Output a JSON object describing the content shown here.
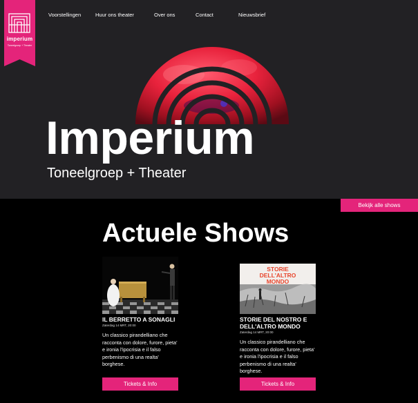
{
  "brand": {
    "logo_text": "imperium",
    "logo_tagline": "Toneelgroep + Theater",
    "color": "#e4247a"
  },
  "nav": {
    "items": [
      {
        "label": "Voorstellingen"
      },
      {
        "label": "Huur ons theater"
      },
      {
        "label": "Over ons"
      },
      {
        "label": "Contact"
      },
      {
        "label": "Nieuwsbrief"
      }
    ]
  },
  "hero": {
    "title": "Imperium",
    "subtitle": "Toneelgroep + Theater"
  },
  "shows_section": {
    "all_shows_label": "Bekijk alle shows",
    "title": "Actuele Shows",
    "shows": [
      {
        "title": "IL BERRETTO A SONAGLI",
        "date": "Zaterdag 14 MRT, 20:00",
        "description": "Un classico pirandelliano che racconta con dolore, furore, pieta' e ironia l'ipocrisia e il falso perbenismo di una realta' borghese.",
        "button_label": "Tickets & Info"
      },
      {
        "title": "STORIE DEL NOSTRO E DELL'ALTRO MONDO",
        "image_caption": "STORIE DELL'ALTRO MONDO",
        "date": "Zaterdag 14 MRT, 20:00",
        "description": "Un classico pirandelliano che racconta con dolore, furore, pieta' e ironia l'ipocrisia e il falso perbenismo di una realta' borghese.",
        "button_label": "Tickets & Info"
      }
    ]
  }
}
